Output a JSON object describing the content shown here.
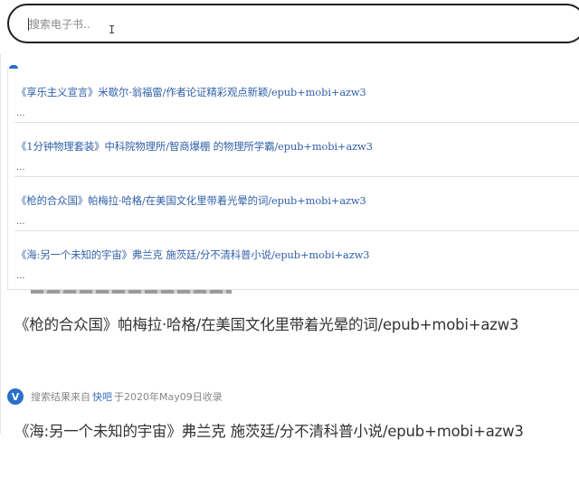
{
  "search": {
    "placeholder": "搜索电子书..",
    "value": ""
  },
  "suggestions": [
    {
      "title": "《享乐主义宣言》米歇尔·翁福雷/作者论证精彩观点新颖/epub+mobi+azw3",
      "snippet": "..."
    },
    {
      "title": "《1分钟物理套装》中科院物理所/智商爆棚 的物理所学霸/epub+mobi+azw3",
      "snippet": "..."
    },
    {
      "title": "《枪的合众国》帕梅拉·哈格/在美国文化里带着光晕的词/epub+mobi+azw3",
      "snippet": "..."
    },
    {
      "title": "《海:另一个未知的宇宙》弗兰克 施茨廷/分不清科普小说/epub+mobi+azw3",
      "snippet": "..."
    }
  ],
  "results": [
    {
      "title": "《枪的合众国》帕梅拉·哈格/在美国文化里带着光晕的词/epub+mobi+azw3"
    },
    {
      "source_prefix": "搜索结果来自",
      "source_name": "快吧",
      "source_suffix": "于2020年May09日收录",
      "title": "《海:另一个未知的宇宙》弗兰克 施茨廷/分不清科普小说/epub+mobi+azw3"
    }
  ],
  "icons": {
    "source_badge": "V"
  },
  "colors": {
    "link": "#2f5fa8",
    "badge": "#2a6fc9"
  }
}
